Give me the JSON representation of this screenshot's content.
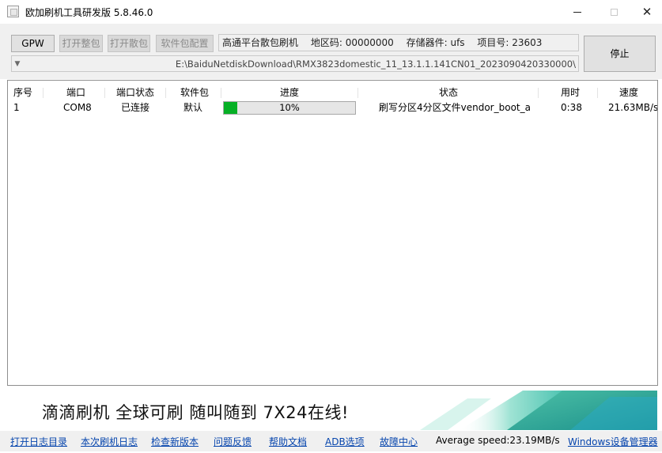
{
  "window": {
    "title": "欧加刷机工具研发版 5.8.46.0",
    "min_label": "—",
    "close_label": "✕"
  },
  "toolbar": {
    "buttons": [
      {
        "label": "GPW",
        "enabled": true
      },
      {
        "label": "打开整包",
        "enabled": false
      },
      {
        "label": "打开散包",
        "enabled": false
      },
      {
        "label": "软件包配置",
        "enabled": false
      }
    ],
    "info": {
      "mode": "高通平台散包刷机",
      "region": "地区码: 00000000",
      "storage": "存储器件: ufs",
      "project": "项目号: 23603"
    },
    "path": "E:\\BaiduNetdiskDownload\\RMX3823domestic_11_13.1.1.141CN01_2023090420330000\\",
    "stop_label": "停止"
  },
  "table": {
    "columns": [
      "序号",
      "端口",
      "端口状态",
      "软件包",
      "进度",
      "状态",
      "用时",
      "速度"
    ],
    "rows": [
      {
        "index": "1",
        "port": "COM8",
        "port_status": "已连接",
        "package": "默认",
        "progress_label": "10%",
        "progress_fraction": 0.1,
        "status": "刷写分区4分区文件vendor_boot_a",
        "elapsed": "0:38",
        "speed": "21.63MB/s"
      }
    ]
  },
  "banner": {
    "text": "滴滴刷机 全球可刷 随叫随到 7X24在线!"
  },
  "footer": {
    "links": [
      "打开日志目录",
      "本次刷机日志",
      "检查新版本",
      "问题反馈",
      "帮助文档",
      "ADB选项",
      "故障中心"
    ],
    "average_speed": "Average speed:23.19MB/s",
    "device_manager": "Windows设备管理器"
  },
  "colors": {
    "progress_fill": "#06b025",
    "link": "#0645ad",
    "toolbar_bg": "#f0f0f0",
    "banner_teal": "#2bb6a3"
  }
}
